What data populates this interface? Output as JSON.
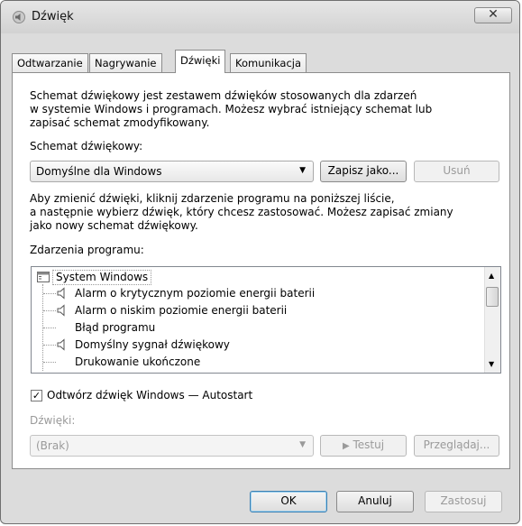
{
  "window": {
    "title": "Dźwięk",
    "close_label": "✕"
  },
  "tabs": [
    {
      "label": "Odtwarzanie"
    },
    {
      "label": "Nagrywanie"
    },
    {
      "label": "Dźwięki"
    },
    {
      "label": "Komunikacja"
    }
  ],
  "intro": [
    "Schemat dźwiękowy jest zestawem dźwięków stosowanych dla zdarzeń",
    "w systemie Windows i programach. Możesz wybrać istniejący schemat lub",
    "zapisać schemat zmodyfikowany."
  ],
  "scheme": {
    "label": "Schemat dźwiękowy:",
    "value": "Domyślne dla Windows",
    "save_as": "Zapisz jako...",
    "delete": "Usuń"
  },
  "change_text": [
    "Aby zmienić dźwięki, kliknij zdarzenie programu na poniższej liście,",
    "a następnie wybierz dźwięk, który chcesz zastosować. Możesz zapisać zmiany",
    "jako nowy schemat dźwiękowy."
  ],
  "events": {
    "label": "Zdarzenia programu:",
    "group": "System Windows",
    "items": [
      {
        "label": "Alarm o krytycznym poziomie energii baterii",
        "icon": "speaker-icon"
      },
      {
        "label": "Alarm o niskim poziomie energii baterii",
        "icon": "speaker-icon"
      },
      {
        "label": "Błąd programu",
        "icon": ""
      },
      {
        "label": "Domyślny sygnał dźwiękowy",
        "icon": "speaker-icon"
      },
      {
        "label": "Drukowanie ukończone",
        "icon": ""
      }
    ]
  },
  "startup": {
    "label": "Odtwórz dźwięk Windows — Autostart",
    "checked": true
  },
  "sounds": {
    "label": "Dźwięki:",
    "value": "(Brak)",
    "test": "Testuj",
    "browse": "Przeglądaj..."
  },
  "footer": {
    "ok": "OK",
    "cancel": "Anuluj",
    "apply": "Zastosuj"
  }
}
